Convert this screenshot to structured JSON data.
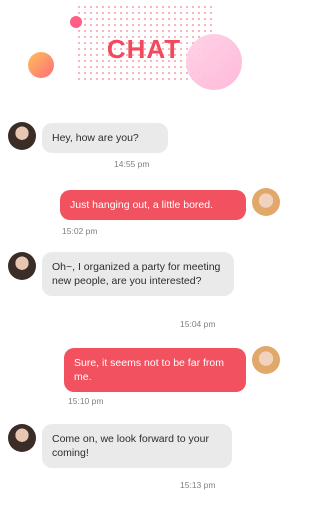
{
  "header": {
    "title": "CHAT"
  },
  "messages": [
    {
      "side": "left",
      "text": "Hey, how are you?",
      "time": "14:55 pm",
      "avatar": "woman-avatar"
    },
    {
      "side": "right",
      "text": "Just hanging out, a little bored.",
      "time": "15:02 pm",
      "avatar": "man-avatar"
    },
    {
      "side": "left",
      "text": "Oh~, I organized a party for meeting new people, are you interested?",
      "time": "15:04 pm",
      "avatar": "woman-avatar"
    },
    {
      "side": "right",
      "text": "Sure, it seems not to be far from me.",
      "time": "15:10 pm",
      "avatar": "man-avatar"
    },
    {
      "side": "left",
      "text": "Come on, we look forward to your coming!",
      "time": "15:13 pm",
      "avatar": "woman-avatar"
    }
  ],
  "colors": {
    "accent": "#f24a5d",
    "bubble_right": "#f2515f",
    "bubble_left": "#eaeaea"
  }
}
